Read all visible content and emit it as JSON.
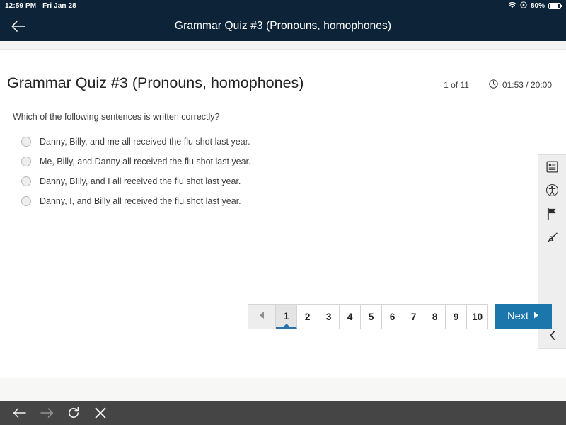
{
  "status_bar": {
    "time": "12:59 PM",
    "date": "Fri Jan 28",
    "battery_percent": "80%",
    "wifi_icon": "wifi-icon",
    "orientation_lock_icon": "orientation-lock-icon",
    "battery_icon": "battery-icon"
  },
  "app_bar": {
    "back_icon": "back-arrow-icon",
    "title": "Grammar Quiz #3  (Pronouns, homophones)"
  },
  "quiz": {
    "title": "Grammar Quiz #3 (Pronouns, homophones)",
    "progress": "1 of 11",
    "timer_icon": "clock-icon",
    "timer": "01:53 / 20:00",
    "question": "Which of the following sentences is written correctly?",
    "options": [
      {
        "label": "Danny, Billy, and me all received the flu shot last year.",
        "selected": false
      },
      {
        "label": "Me, Billy, and Danny all received the flu shot last year.",
        "selected": false
      },
      {
        "label": "Danny, BIlly, and I all received the flu shot last year.",
        "selected": false
      },
      {
        "label": "Danny, I, and Billy all received the flu shot last year.",
        "selected": false
      }
    ]
  },
  "tool_rail": {
    "items": [
      {
        "icon": "reference-sheet-icon",
        "name": "reference-sheet"
      },
      {
        "icon": "accessibility-icon",
        "name": "accessibility"
      },
      {
        "icon": "flag-icon",
        "name": "flag-question"
      },
      {
        "icon": "strikethrough-answer-icon",
        "name": "answer-eliminator"
      }
    ],
    "collapse_icon": "chevron-left-icon"
  },
  "pagination": {
    "prev_icon": "triangle-left-icon",
    "pages": [
      "1",
      "2",
      "3",
      "4",
      "5",
      "6",
      "7",
      "8",
      "9",
      "10"
    ],
    "active_page": "1",
    "next_label": "Next",
    "next_icon": "triangle-right-icon"
  },
  "browser_bar": {
    "back_icon": "arrow-left-icon",
    "forward_icon": "arrow-right-icon",
    "reload_icon": "reload-icon",
    "close_icon": "close-x-icon"
  },
  "colors": {
    "header_navy": "#0d2438",
    "accent_blue": "#1b76ab",
    "active_underline": "#2a72a8",
    "browser_bar": "#454545"
  }
}
